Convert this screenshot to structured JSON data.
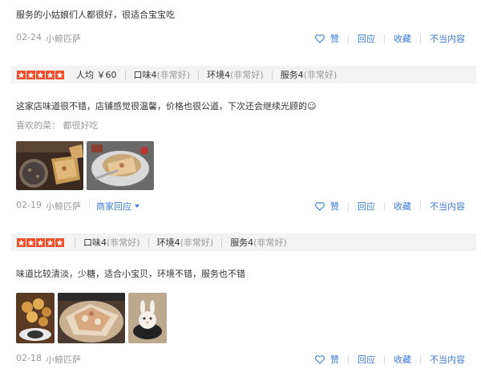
{
  "review1": {
    "text": "服务的小姑娘们人都很好，很适合宝宝吃",
    "date": "02-24",
    "user": "小鲸匹萨"
  },
  "review2": {
    "rating_stars": 5,
    "per_capita": "人均 ￥60",
    "taste": "口味4",
    "taste_note": "(非常好)",
    "env": "环境4",
    "env_note": "(非常好)",
    "service": "服务4",
    "service_note": "(非常好)",
    "text": "这家店味道很不错，店铺感觉很温馨，价格也很公道，下次还会继续光顾的☺",
    "liked": "喜欢的菜：  都很好吃",
    "date": "02-19",
    "user": "小鲸匹萨",
    "merchant_reply": "商家回应"
  },
  "review3": {
    "rating_stars": 5,
    "taste": "口味4",
    "taste_note": "(非常好)",
    "env": "环境4",
    "env_note": "(非常好)",
    "service": "服务4",
    "service_note": "(非常好)",
    "text": "味道比较清淡，少糖，适合小宝贝，环境不错，服务也不错",
    "date": "02-18",
    "user": "小鲸匹萨"
  },
  "actions": {
    "like": "赞",
    "reply": "回应",
    "favorite": "收藏",
    "report": "不当内容"
  },
  "colors": {
    "accent": "#3a7bd5",
    "star": "#f24e2b",
    "muted": "#999999"
  }
}
